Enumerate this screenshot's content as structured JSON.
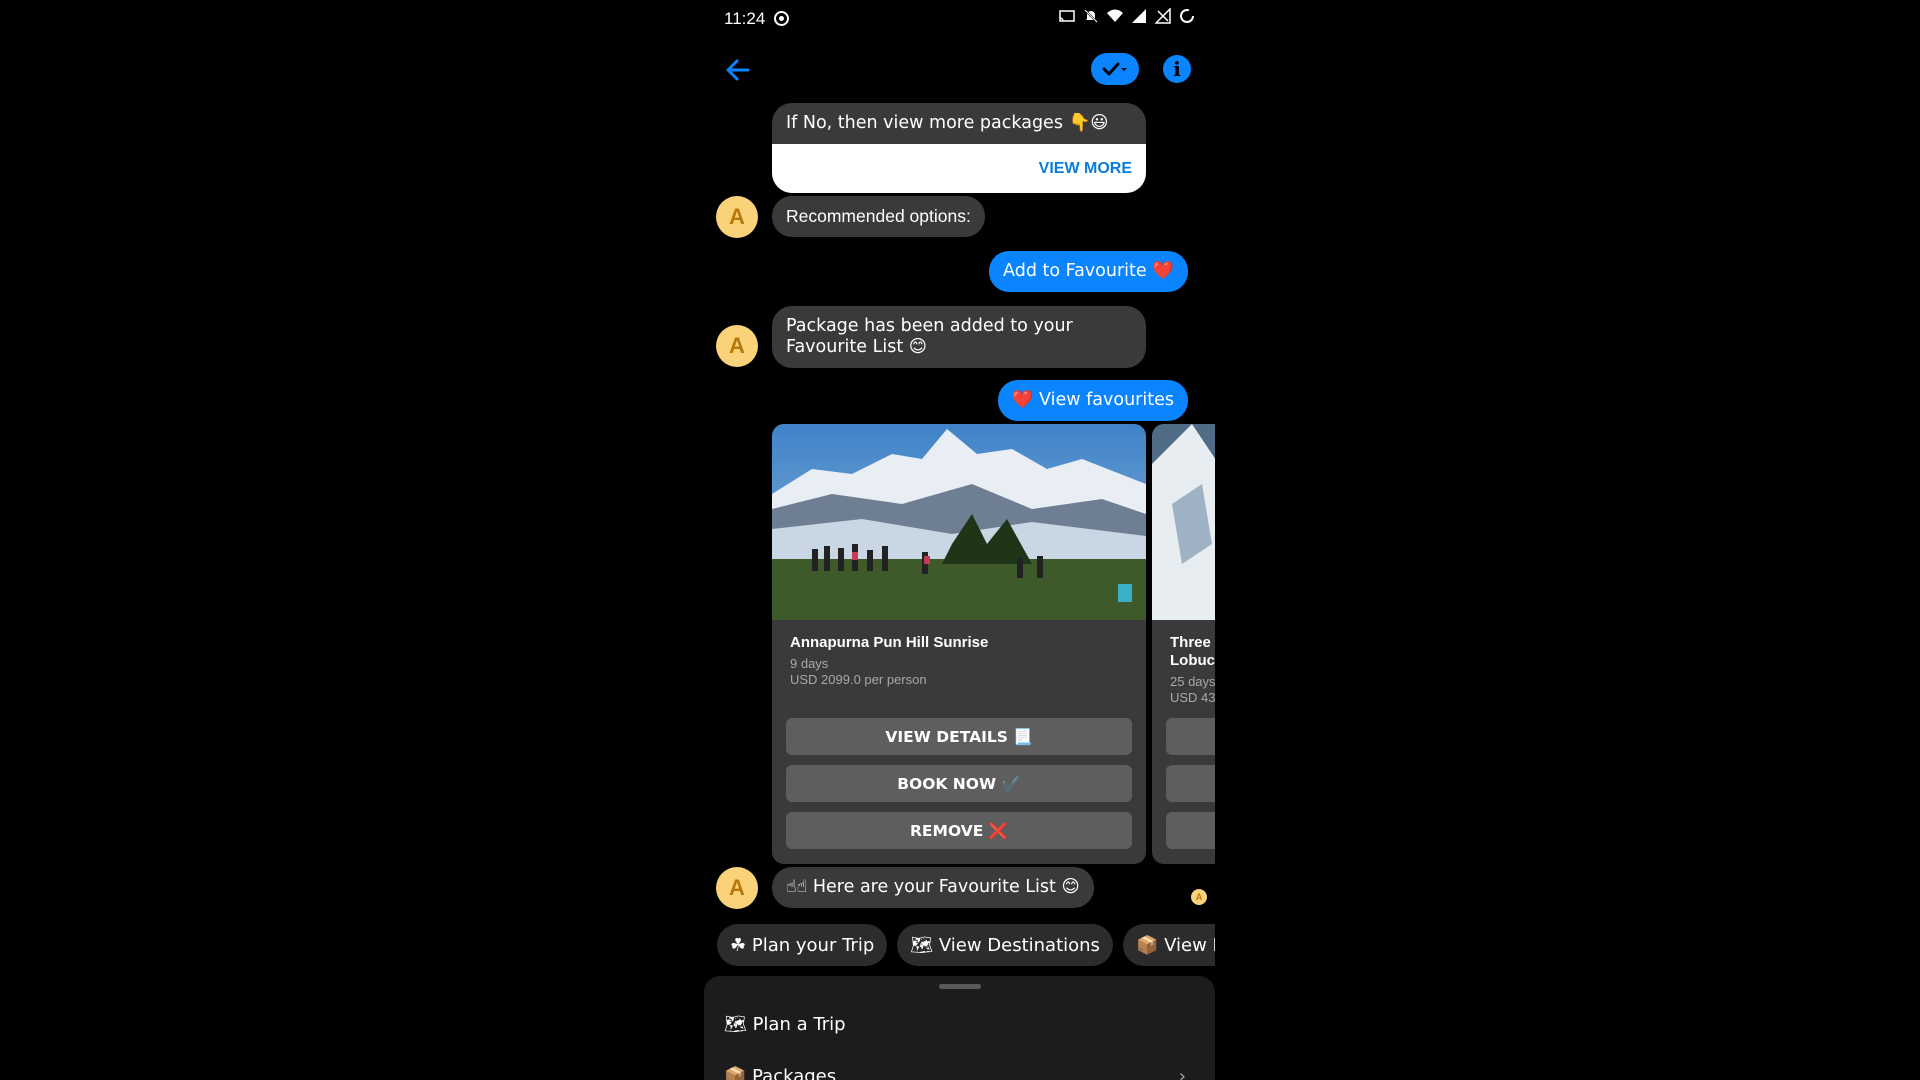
{
  "status_bar": {
    "time": "11:24"
  },
  "header": {
    "back_icon": "back-arrow-icon",
    "check_icon": "check-icon",
    "info_icon": "info-icon",
    "info_glyph": "i"
  },
  "messages": {
    "view_more_card": {
      "text": "If No, then view more packages 👇😃",
      "button": "VIEW MORE"
    },
    "recommended": "Recommended options:",
    "add_favourite": "Add to Favourite ❤️",
    "package_added": "Package has been added to your Favourite List 😊",
    "view_favourites": "❤️ View favourites",
    "favourite_list": "☝☝ Here are your Favourite List 😊"
  },
  "avatar_letter": "A",
  "packages": [
    {
      "title": "Annapurna Pun Hill Sunrise",
      "duration": "9 days",
      "price": "USD 2099.0 per person",
      "buttons": {
        "details": "VIEW DETAILS 📃",
        "book": "BOOK NOW ✔️",
        "remove": "REMOVE ❌"
      }
    },
    {
      "title_line1": "Three",
      "title_line2": "Lobucl",
      "duration": "25 days",
      "price": "USD 43"
    }
  ],
  "quick_replies": [
    "☘ Plan your Trip",
    "🗺 View Destinations",
    "📦 View Pack"
  ],
  "menu": [
    {
      "label": "🗺 Plan a Trip"
    },
    {
      "label": "📦 Packages",
      "chevron": "›"
    }
  ],
  "colors": {
    "accent": "#0a84ff",
    "bubble": "#3a3a3c",
    "avatar": "#f9d27a"
  }
}
